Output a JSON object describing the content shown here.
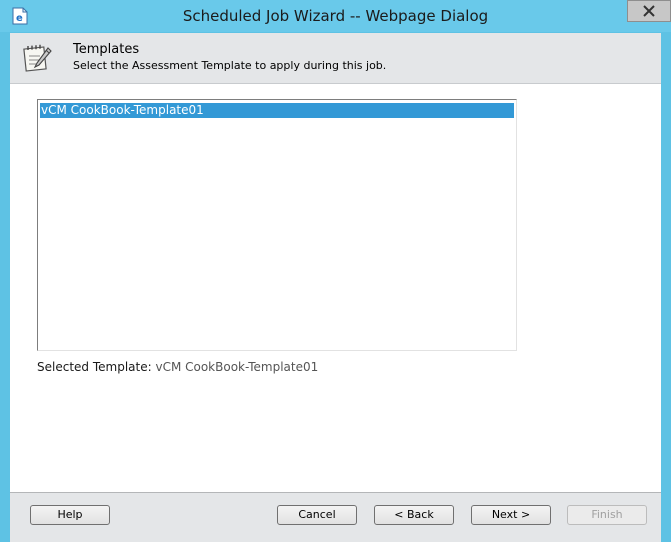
{
  "window": {
    "title": "Scheduled Job Wizard -- Webpage Dialog",
    "app_icon": "ie-page-icon",
    "close_icon": "close-icon"
  },
  "header": {
    "icon": "notepad-pencil-icon",
    "title": "Templates",
    "subtitle": "Select the Assessment Template to apply during this job."
  },
  "templates": {
    "items": [
      "vCM CookBook-Template01"
    ],
    "selected_index": 0
  },
  "selected": {
    "label": "Selected Template:",
    "value": "vCM CookBook-Template01"
  },
  "footer": {
    "help_label": "Help",
    "cancel_label": "Cancel",
    "back_label": "< Back",
    "next_label": "Next >",
    "finish_label": "Finish",
    "finish_enabled": false
  }
}
